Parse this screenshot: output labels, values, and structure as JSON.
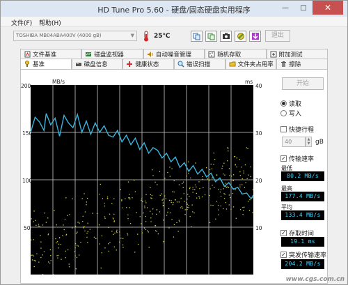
{
  "window": {
    "title": "HD Tune Pro 5.60 - 硬盘/固态硬盘实用程序"
  },
  "menu": {
    "file": "文件(F)",
    "help": "帮助(H)"
  },
  "toolbar": {
    "drive": "TOSHIBA MB04ABA400V (4000 gB)",
    "temperature": "25℃",
    "exit_label": "退出",
    "icons": [
      "copy-icon",
      "copy-all-icon",
      "camera-icon",
      "tools-icon",
      "download-icon"
    ]
  },
  "tabs_top": [
    {
      "label": "文件基准",
      "icon": "file-benchmark-icon"
    },
    {
      "label": "磁盘监视器",
      "icon": "disk-monitor-icon"
    },
    {
      "label": "自动噪音管理",
      "icon": "speaker-icon"
    },
    {
      "label": "随机存取",
      "icon": "random-access-icon"
    },
    {
      "label": "附加测试",
      "icon": "extra-tests-icon"
    }
  ],
  "tabs_bottom": [
    {
      "label": "基准",
      "icon": "benchmark-icon",
      "active": true
    },
    {
      "label": "磁盘信息",
      "icon": "disk-info-icon"
    },
    {
      "label": "健康状态",
      "icon": "health-icon"
    },
    {
      "label": "错误扫描",
      "icon": "error-scan-icon"
    },
    {
      "label": "文件夹占用率",
      "icon": "folder-usage-icon"
    },
    {
      "label": "擦除",
      "icon": "erase-icon"
    }
  ],
  "sidebar": {
    "start_label": "开始",
    "read_label": "读取",
    "write_label": "写入",
    "mode": "read",
    "short_stroke_label": "快捷行程",
    "short_stroke_checked": false,
    "short_stroke_value": "40",
    "short_stroke_unit": "gB",
    "transfer_rate_label": "传输速率",
    "transfer_rate_checked": true,
    "min_label": "最低",
    "min_value": "80.2 MB/s",
    "max_label": "最高",
    "max_value": "177.4 MB/s",
    "avg_label": "平均",
    "avg_value": "133.4 MB/s",
    "access_time_label": "存取时间",
    "access_time_checked": true,
    "access_time_value": "19.1 ms",
    "burst_rate_label": "突发传输速率",
    "burst_rate_checked": true,
    "burst_rate_value": "204.2 MB/s"
  },
  "watermark": "www.cgs.com.cn",
  "colors": {
    "plot_background": "#000000",
    "gridline": "#cfcfcf",
    "transfer_line": "#3ab4dc",
    "access_points": "#cfcf4a",
    "stat_text": "#3fd6ff"
  },
  "chart_data": {
    "type": "line",
    "y_left_unit": "MB/s",
    "y_right_unit": "ms",
    "y_left_range": [
      0,
      200
    ],
    "y_right_range": [
      0,
      40
    ],
    "y_left_ticks": [
      "200",
      "150",
      "100",
      "50"
    ],
    "y_right_ticks": [
      "40",
      "30",
      "20",
      "10"
    ],
    "x_range": [
      0,
      100
    ],
    "grid": true,
    "series": [
      {
        "key": "transfer",
        "points": [
          [
            0,
            150
          ],
          [
            2,
            166
          ],
          [
            4,
            161
          ],
          [
            6,
            152
          ],
          [
            7,
            170
          ],
          [
            9,
            158
          ],
          [
            11,
            165
          ],
          [
            13,
            146
          ],
          [
            15,
            168
          ],
          [
            17,
            160
          ],
          [
            19,
            155
          ],
          [
            21,
            169
          ],
          [
            23,
            150
          ],
          [
            25,
            162
          ],
          [
            27,
            148
          ],
          [
            29,
            160
          ],
          [
            31,
            150
          ],
          [
            33,
            157
          ],
          [
            35,
            147
          ],
          [
            37,
            145
          ],
          [
            39,
            152
          ],
          [
            41,
            140
          ],
          [
            43,
            147
          ],
          [
            45,
            137
          ],
          [
            47,
            144
          ],
          [
            49,
            132
          ],
          [
            51,
            139
          ],
          [
            53,
            128
          ],
          [
            55,
            134
          ],
          [
            57,
            131
          ],
          [
            59,
            123
          ],
          [
            61,
            128
          ],
          [
            63,
            119
          ],
          [
            65,
            124
          ],
          [
            67,
            113
          ],
          [
            69,
            118
          ],
          [
            71,
            109
          ],
          [
            73,
            115
          ],
          [
            75,
            106
          ],
          [
            77,
            111
          ],
          [
            79,
            103
          ],
          [
            81,
            107
          ],
          [
            83,
            98
          ],
          [
            85,
            102
          ],
          [
            87,
            93
          ],
          [
            89,
            97
          ],
          [
            91,
            90
          ],
          [
            93,
            92
          ],
          [
            95,
            85
          ],
          [
            97,
            86
          ],
          [
            99,
            80
          ],
          [
            100,
            84
          ]
        ]
      },
      {
        "key": "access_time",
        "trend": [
          [
            0,
            5.5
          ],
          [
            100,
            21
          ]
        ],
        "count": 420,
        "spread_ms": 9
      }
    ]
  }
}
